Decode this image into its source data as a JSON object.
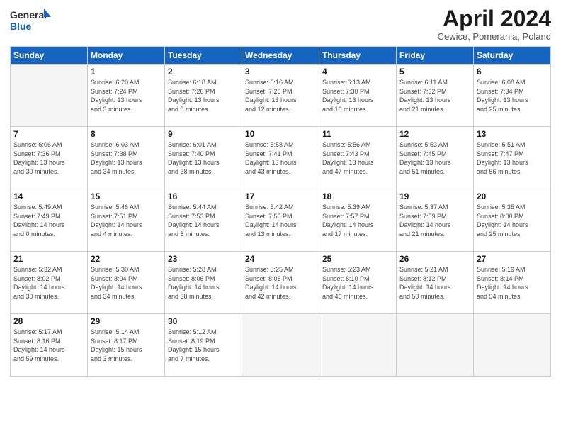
{
  "header": {
    "logo_general": "General",
    "logo_blue": "Blue",
    "month_title": "April 2024",
    "subtitle": "Cewice, Pomerania, Poland"
  },
  "days_of_week": [
    "Sunday",
    "Monday",
    "Tuesday",
    "Wednesday",
    "Thursday",
    "Friday",
    "Saturday"
  ],
  "weeks": [
    [
      {
        "day": "",
        "detail": ""
      },
      {
        "day": "1",
        "detail": "Sunrise: 6:20 AM\nSunset: 7:24 PM\nDaylight: 13 hours\nand 3 minutes."
      },
      {
        "day": "2",
        "detail": "Sunrise: 6:18 AM\nSunset: 7:26 PM\nDaylight: 13 hours\nand 8 minutes."
      },
      {
        "day": "3",
        "detail": "Sunrise: 6:16 AM\nSunset: 7:28 PM\nDaylight: 13 hours\nand 12 minutes."
      },
      {
        "day": "4",
        "detail": "Sunrise: 6:13 AM\nSunset: 7:30 PM\nDaylight: 13 hours\nand 16 minutes."
      },
      {
        "day": "5",
        "detail": "Sunrise: 6:11 AM\nSunset: 7:32 PM\nDaylight: 13 hours\nand 21 minutes."
      },
      {
        "day": "6",
        "detail": "Sunrise: 6:08 AM\nSunset: 7:34 PM\nDaylight: 13 hours\nand 25 minutes."
      }
    ],
    [
      {
        "day": "7",
        "detail": "Sunrise: 6:06 AM\nSunset: 7:36 PM\nDaylight: 13 hours\nand 30 minutes."
      },
      {
        "day": "8",
        "detail": "Sunrise: 6:03 AM\nSunset: 7:38 PM\nDaylight: 13 hours\nand 34 minutes."
      },
      {
        "day": "9",
        "detail": "Sunrise: 6:01 AM\nSunset: 7:40 PM\nDaylight: 13 hours\nand 38 minutes."
      },
      {
        "day": "10",
        "detail": "Sunrise: 5:58 AM\nSunset: 7:41 PM\nDaylight: 13 hours\nand 43 minutes."
      },
      {
        "day": "11",
        "detail": "Sunrise: 5:56 AM\nSunset: 7:43 PM\nDaylight: 13 hours\nand 47 minutes."
      },
      {
        "day": "12",
        "detail": "Sunrise: 5:53 AM\nSunset: 7:45 PM\nDaylight: 13 hours\nand 51 minutes."
      },
      {
        "day": "13",
        "detail": "Sunrise: 5:51 AM\nSunset: 7:47 PM\nDaylight: 13 hours\nand 56 minutes."
      }
    ],
    [
      {
        "day": "14",
        "detail": "Sunrise: 5:49 AM\nSunset: 7:49 PM\nDaylight: 14 hours\nand 0 minutes."
      },
      {
        "day": "15",
        "detail": "Sunrise: 5:46 AM\nSunset: 7:51 PM\nDaylight: 14 hours\nand 4 minutes."
      },
      {
        "day": "16",
        "detail": "Sunrise: 5:44 AM\nSunset: 7:53 PM\nDaylight: 14 hours\nand 8 minutes."
      },
      {
        "day": "17",
        "detail": "Sunrise: 5:42 AM\nSunset: 7:55 PM\nDaylight: 14 hours\nand 13 minutes."
      },
      {
        "day": "18",
        "detail": "Sunrise: 5:39 AM\nSunset: 7:57 PM\nDaylight: 14 hours\nand 17 minutes."
      },
      {
        "day": "19",
        "detail": "Sunrise: 5:37 AM\nSunset: 7:59 PM\nDaylight: 14 hours\nand 21 minutes."
      },
      {
        "day": "20",
        "detail": "Sunrise: 5:35 AM\nSunset: 8:00 PM\nDaylight: 14 hours\nand 25 minutes."
      }
    ],
    [
      {
        "day": "21",
        "detail": "Sunrise: 5:32 AM\nSunset: 8:02 PM\nDaylight: 14 hours\nand 30 minutes."
      },
      {
        "day": "22",
        "detail": "Sunrise: 5:30 AM\nSunset: 8:04 PM\nDaylight: 14 hours\nand 34 minutes."
      },
      {
        "day": "23",
        "detail": "Sunrise: 5:28 AM\nSunset: 8:06 PM\nDaylight: 14 hours\nand 38 minutes."
      },
      {
        "day": "24",
        "detail": "Sunrise: 5:25 AM\nSunset: 8:08 PM\nDaylight: 14 hours\nand 42 minutes."
      },
      {
        "day": "25",
        "detail": "Sunrise: 5:23 AM\nSunset: 8:10 PM\nDaylight: 14 hours\nand 46 minutes."
      },
      {
        "day": "26",
        "detail": "Sunrise: 5:21 AM\nSunset: 8:12 PM\nDaylight: 14 hours\nand 50 minutes."
      },
      {
        "day": "27",
        "detail": "Sunrise: 5:19 AM\nSunset: 8:14 PM\nDaylight: 14 hours\nand 54 minutes."
      }
    ],
    [
      {
        "day": "28",
        "detail": "Sunrise: 5:17 AM\nSunset: 8:16 PM\nDaylight: 14 hours\nand 59 minutes."
      },
      {
        "day": "29",
        "detail": "Sunrise: 5:14 AM\nSunset: 8:17 PM\nDaylight: 15 hours\nand 3 minutes."
      },
      {
        "day": "30",
        "detail": "Sunrise: 5:12 AM\nSunset: 8:19 PM\nDaylight: 15 hours\nand 7 minutes."
      },
      {
        "day": "",
        "detail": ""
      },
      {
        "day": "",
        "detail": ""
      },
      {
        "day": "",
        "detail": ""
      },
      {
        "day": "",
        "detail": ""
      }
    ]
  ]
}
